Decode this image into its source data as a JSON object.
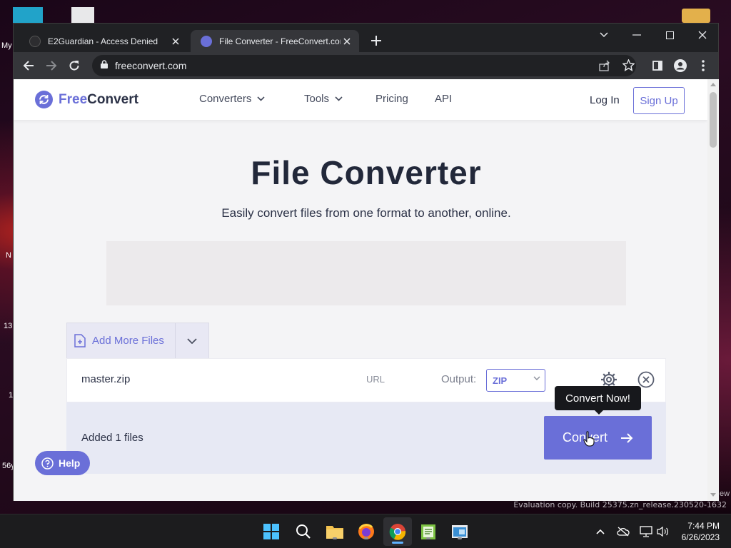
{
  "desktop": {
    "icon_labels": [
      "My",
      "N",
      "13",
      "1",
      "56y"
    ],
    "right_edge_text": "ew",
    "evaluation": "Evaluation copy. Build 25375.zn_release.230520-1632"
  },
  "browser": {
    "tabs": [
      {
        "title": "E2Guardian - Access Denied",
        "active": false
      },
      {
        "title": "File Converter - FreeConvert.com",
        "active": true
      }
    ],
    "url": "freeconvert.com"
  },
  "site": {
    "logo": {
      "part1": "Free",
      "part2": "Convert"
    },
    "nav": {
      "converters": "Converters",
      "tools": "Tools",
      "pricing": "Pricing",
      "api": "API"
    },
    "login": "Log In",
    "signup": "Sign Up",
    "hero": {
      "title": "File Converter",
      "subtitle": "Easily convert files from one format to another, online."
    },
    "uploader": {
      "add_more": "Add More Files",
      "file": {
        "name": "master.zip",
        "source": "URL",
        "output_label": "Output:",
        "format": "ZIP"
      },
      "added_count": "Added 1 files",
      "convert_label": "Convert",
      "tooltip": "Convert Now!"
    },
    "help": "Help",
    "accent_color": "#6a6fd8"
  },
  "taskbar": {
    "time": "7:44 PM",
    "date": "6/26/2023",
    "apps": [
      "start-icon",
      "search-icon",
      "file-explorer-icon",
      "firefox-icon",
      "chrome-icon",
      "notepad-app-icon",
      "remote-app-icon"
    ]
  }
}
